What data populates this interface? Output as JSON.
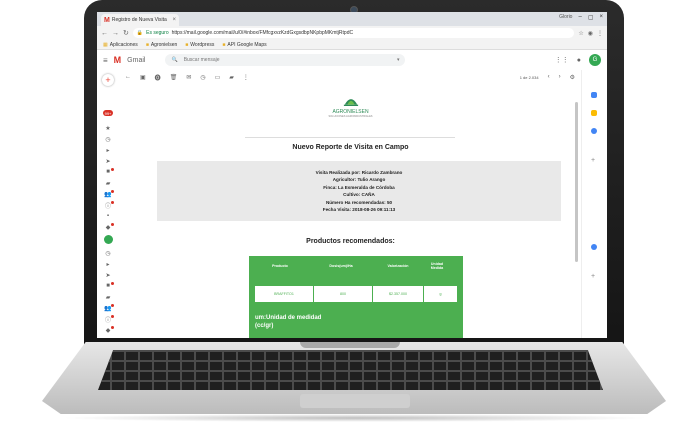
{
  "browser": {
    "tab_title": "Registro de Nueva Visita",
    "user_label": "Glorio",
    "secure_label": "Es seguro",
    "url": "https://mail.google.com/mail/u/0/#inbox/FMfcgxvzKzdGxgsdbpNKpbpMKmtjRtpdC",
    "bookmarks": [
      "Aplicaciones",
      "Agronielsen",
      "Wordpress",
      "API Google Maps"
    ]
  },
  "gmail": {
    "brand": "Gmail",
    "search_placeholder": "Buscar mensaje",
    "account_initial": "G",
    "page_count": "1 de 2.034",
    "badge_count": "99+"
  },
  "email": {
    "logo_name": "AGRONIELSEN",
    "logo_sub": "SOLUCIONES AGROINDUSTRIALES",
    "title": "Nuevo Reporte de Visita en Campo",
    "info": [
      "Visita Realizada por: Ricardo Zambrano",
      "Agricultor: Tulio Arango",
      "Finca: La Esmeralda de Córdoba",
      "Cultivo: CAÑA",
      "Número Ha recomendadas: 50",
      "Fecha Visita: 2018-08-26 09:11:13"
    ],
    "products_title": "Productos recomendados:",
    "table": {
      "headers": [
        "Producto",
        "Dosis(um)/Ha",
        "Valorización",
        "Unidad Medida"
      ],
      "rows": [
        [
          "BRAFFITO1",
          "800",
          "$2.357.000",
          "g"
        ]
      ]
    },
    "um_note": "um:Unidad de medidad (cc/gr)"
  },
  "colors": {
    "accent_green": "#4caf50",
    "gmail_red": "#d93025"
  }
}
